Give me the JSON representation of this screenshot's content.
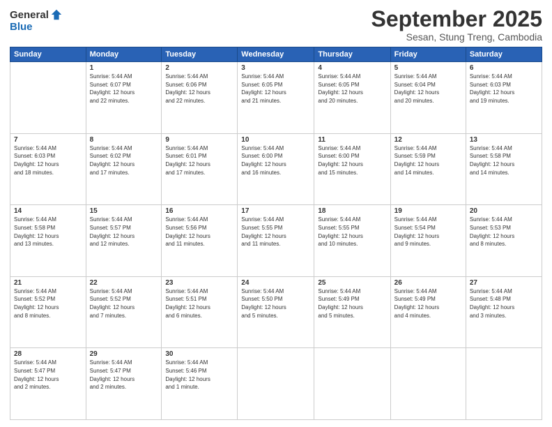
{
  "header": {
    "logo_general": "General",
    "logo_blue": "Blue",
    "month_title": "September 2025",
    "subtitle": "Sesan, Stung Treng, Cambodia"
  },
  "days_of_week": [
    "Sunday",
    "Monday",
    "Tuesday",
    "Wednesday",
    "Thursday",
    "Friday",
    "Saturday"
  ],
  "weeks": [
    [
      {
        "day": "",
        "text": ""
      },
      {
        "day": "1",
        "text": "Sunrise: 5:44 AM\nSunset: 6:07 PM\nDaylight: 12 hours\nand 22 minutes."
      },
      {
        "day": "2",
        "text": "Sunrise: 5:44 AM\nSunset: 6:06 PM\nDaylight: 12 hours\nand 22 minutes."
      },
      {
        "day": "3",
        "text": "Sunrise: 5:44 AM\nSunset: 6:05 PM\nDaylight: 12 hours\nand 21 minutes."
      },
      {
        "day": "4",
        "text": "Sunrise: 5:44 AM\nSunset: 6:05 PM\nDaylight: 12 hours\nand 20 minutes."
      },
      {
        "day": "5",
        "text": "Sunrise: 5:44 AM\nSunset: 6:04 PM\nDaylight: 12 hours\nand 20 minutes."
      },
      {
        "day": "6",
        "text": "Sunrise: 5:44 AM\nSunset: 6:03 PM\nDaylight: 12 hours\nand 19 minutes."
      }
    ],
    [
      {
        "day": "7",
        "text": "Sunrise: 5:44 AM\nSunset: 6:03 PM\nDaylight: 12 hours\nand 18 minutes."
      },
      {
        "day": "8",
        "text": "Sunrise: 5:44 AM\nSunset: 6:02 PM\nDaylight: 12 hours\nand 17 minutes."
      },
      {
        "day": "9",
        "text": "Sunrise: 5:44 AM\nSunset: 6:01 PM\nDaylight: 12 hours\nand 17 minutes."
      },
      {
        "day": "10",
        "text": "Sunrise: 5:44 AM\nSunset: 6:00 PM\nDaylight: 12 hours\nand 16 minutes."
      },
      {
        "day": "11",
        "text": "Sunrise: 5:44 AM\nSunset: 6:00 PM\nDaylight: 12 hours\nand 15 minutes."
      },
      {
        "day": "12",
        "text": "Sunrise: 5:44 AM\nSunset: 5:59 PM\nDaylight: 12 hours\nand 14 minutes."
      },
      {
        "day": "13",
        "text": "Sunrise: 5:44 AM\nSunset: 5:58 PM\nDaylight: 12 hours\nand 14 minutes."
      }
    ],
    [
      {
        "day": "14",
        "text": "Sunrise: 5:44 AM\nSunset: 5:58 PM\nDaylight: 12 hours\nand 13 minutes."
      },
      {
        "day": "15",
        "text": "Sunrise: 5:44 AM\nSunset: 5:57 PM\nDaylight: 12 hours\nand 12 minutes."
      },
      {
        "day": "16",
        "text": "Sunrise: 5:44 AM\nSunset: 5:56 PM\nDaylight: 12 hours\nand 11 minutes."
      },
      {
        "day": "17",
        "text": "Sunrise: 5:44 AM\nSunset: 5:55 PM\nDaylight: 12 hours\nand 11 minutes."
      },
      {
        "day": "18",
        "text": "Sunrise: 5:44 AM\nSunset: 5:55 PM\nDaylight: 12 hours\nand 10 minutes."
      },
      {
        "day": "19",
        "text": "Sunrise: 5:44 AM\nSunset: 5:54 PM\nDaylight: 12 hours\nand 9 minutes."
      },
      {
        "day": "20",
        "text": "Sunrise: 5:44 AM\nSunset: 5:53 PM\nDaylight: 12 hours\nand 8 minutes."
      }
    ],
    [
      {
        "day": "21",
        "text": "Sunrise: 5:44 AM\nSunset: 5:52 PM\nDaylight: 12 hours\nand 8 minutes."
      },
      {
        "day": "22",
        "text": "Sunrise: 5:44 AM\nSunset: 5:52 PM\nDaylight: 12 hours\nand 7 minutes."
      },
      {
        "day": "23",
        "text": "Sunrise: 5:44 AM\nSunset: 5:51 PM\nDaylight: 12 hours\nand 6 minutes."
      },
      {
        "day": "24",
        "text": "Sunrise: 5:44 AM\nSunset: 5:50 PM\nDaylight: 12 hours\nand 5 minutes."
      },
      {
        "day": "25",
        "text": "Sunrise: 5:44 AM\nSunset: 5:49 PM\nDaylight: 12 hours\nand 5 minutes."
      },
      {
        "day": "26",
        "text": "Sunrise: 5:44 AM\nSunset: 5:49 PM\nDaylight: 12 hours\nand 4 minutes."
      },
      {
        "day": "27",
        "text": "Sunrise: 5:44 AM\nSunset: 5:48 PM\nDaylight: 12 hours\nand 3 minutes."
      }
    ],
    [
      {
        "day": "28",
        "text": "Sunrise: 5:44 AM\nSunset: 5:47 PM\nDaylight: 12 hours\nand 2 minutes."
      },
      {
        "day": "29",
        "text": "Sunrise: 5:44 AM\nSunset: 5:47 PM\nDaylight: 12 hours\nand 2 minutes."
      },
      {
        "day": "30",
        "text": "Sunrise: 5:44 AM\nSunset: 5:46 PM\nDaylight: 12 hours\nand 1 minute."
      },
      {
        "day": "",
        "text": ""
      },
      {
        "day": "",
        "text": ""
      },
      {
        "day": "",
        "text": ""
      },
      {
        "day": "",
        "text": ""
      }
    ]
  ]
}
